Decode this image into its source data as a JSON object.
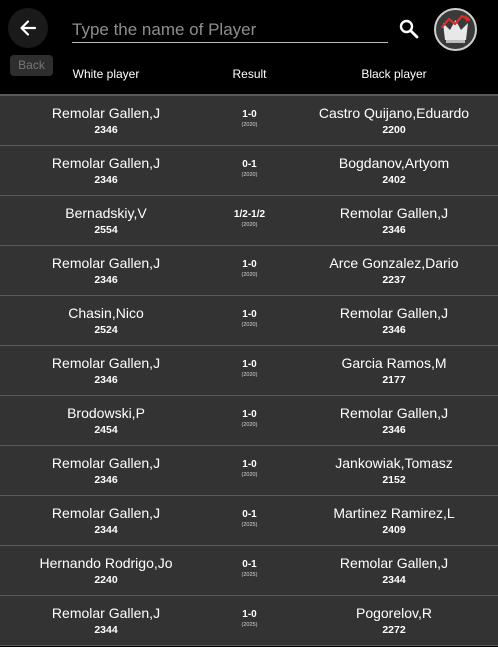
{
  "header": {
    "back_label": "Back",
    "search_placeholder": "Type the name of Player",
    "search_value": ""
  },
  "columns": {
    "white": "White player",
    "result": "Result",
    "black": "Black player"
  },
  "games": [
    {
      "white": "Remolar Gallen,J",
      "white_rating": "2346",
      "result": "1-0",
      "year": "(2020)",
      "black": "Castro Quijano,Eduardo",
      "black_rating": "2200"
    },
    {
      "white": "Remolar Gallen,J",
      "white_rating": "2346",
      "result": "0-1",
      "year": "(2020)",
      "black": "Bogdanov,Artyom",
      "black_rating": "2402"
    },
    {
      "white": "Bernadskiy,V",
      "white_rating": "2554",
      "result": "1/2-1/2",
      "year": "(2020)",
      "black": "Remolar Gallen,J",
      "black_rating": "2346"
    },
    {
      "white": "Remolar Gallen,J",
      "white_rating": "2346",
      "result": "1-0",
      "year": "(2020)",
      "black": "Arce Gonzalez,Dario",
      "black_rating": "2237"
    },
    {
      "white": "Chasin,Nico",
      "white_rating": "2524",
      "result": "1-0",
      "year": "(2020)",
      "black": "Remolar Gallen,J",
      "black_rating": "2346"
    },
    {
      "white": "Remolar Gallen,J",
      "white_rating": "2346",
      "result": "1-0",
      "year": "(2020)",
      "black": "Garcia Ramos,M",
      "black_rating": "2177"
    },
    {
      "white": "Brodowski,P",
      "white_rating": "2454",
      "result": "1-0",
      "year": "(2020)",
      "black": "Remolar Gallen,J",
      "black_rating": "2346"
    },
    {
      "white": "Remolar Gallen,J",
      "white_rating": "2346",
      "result": "1-0",
      "year": "(2020)",
      "black": "Jankowiak,Tomasz",
      "black_rating": "2152"
    },
    {
      "white": "Remolar Gallen,J",
      "white_rating": "2344",
      "result": "0-1",
      "year": "(2025)",
      "black": "Martinez Ramirez,L",
      "black_rating": "2409"
    },
    {
      "white": "Hernando Rodrigo,Jo",
      "white_rating": "2240",
      "result": "0-1",
      "year": "(2025)",
      "black": "Remolar Gallen,J",
      "black_rating": "2344"
    },
    {
      "white": "Remolar Gallen,J",
      "white_rating": "2344",
      "result": "1-0",
      "year": "(2025)",
      "black": "Pogorelov,R",
      "black_rating": "2272"
    }
  ],
  "icons": {
    "back": "arrow-left-icon",
    "search": "search-icon",
    "logo": "crown-logo-icon"
  },
  "colors": {
    "background": "#000000",
    "row": "#333333",
    "divider": "#5b5b5b",
    "logo_accent": "#d32f2f"
  }
}
